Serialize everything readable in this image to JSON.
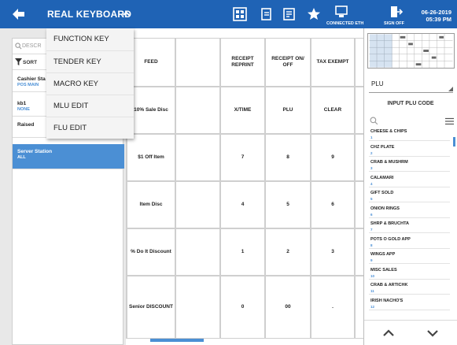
{
  "header": {
    "title": "REAL KEYBOARD",
    "connected_label": "CONNECTED ETH",
    "signoff_label": "SIGN OFF",
    "date": "06-26-2019",
    "time": "05:39 PM"
  },
  "dropdown_menu": {
    "items": [
      {
        "label": "FUNCTION KEY"
      },
      {
        "label": "TENDER KEY"
      },
      {
        "label": "MACRO KEY"
      },
      {
        "label": "MLU EDIT"
      },
      {
        "label": "FLU EDIT"
      }
    ]
  },
  "left_panel": {
    "search_placeholder": "DESCR",
    "sort_label": "SORT",
    "keyboards": [
      {
        "name": "Cashier Sta",
        "sub": "POS MAIN",
        "selected": false
      },
      {
        "name": "kb1",
        "sub": "NONE",
        "selected": false
      },
      {
        "name": "Raised",
        "sub": "",
        "selected": false
      },
      {
        "name": "Server Station",
        "sub": "ALL",
        "selected": true
      }
    ]
  },
  "keys": {
    "rows": [
      [
        "FEED",
        "",
        "RECEIPT REPRINT",
        "RECEIPT ON/ OFF",
        "TAX EXEMPT",
        ""
      ],
      [
        "10% Sale Disc",
        "",
        "X/TIME",
        "PLU",
        "CLEAR",
        ""
      ],
      [
        "$1 Off Item",
        "",
        "7",
        "8",
        "9",
        ""
      ],
      [
        "Item Disc",
        "",
        "4",
        "5",
        "6",
        ""
      ],
      [
        "% Do It Discount",
        "",
        "1",
        "2",
        "3",
        ""
      ],
      [
        "Senior DISCOUNT",
        "",
        "0",
        "00",
        ".",
        ""
      ]
    ]
  },
  "right_panel": {
    "type_select": "PLU",
    "input_button": "INPUT PLU CODE",
    "plu_items": [
      {
        "name": "CHEESE & CHIPS",
        "code": "1"
      },
      {
        "name": "CHZ PLATE",
        "code": "2"
      },
      {
        "name": "CRAB & MUSHRM",
        "code": "3"
      },
      {
        "name": "CALAMARI",
        "code": "4"
      },
      {
        "name": "GIFT SOLD",
        "code": "5"
      },
      {
        "name": "ONION RINGS",
        "code": "6"
      },
      {
        "name": "SHRP & BRUCHTA",
        "code": "7"
      },
      {
        "name": "POTS O GOLD APP",
        "code": "8"
      },
      {
        "name": "WINGS APP",
        "code": "9"
      },
      {
        "name": "MISC SALES",
        "code": "10"
      },
      {
        "name": "CRAB & ARTICHK",
        "code": "11"
      },
      {
        "name": "IRISH NACHO'S",
        "code": "12"
      }
    ]
  },
  "icons": {
    "back": "arrow-left-icon",
    "caret": "chevron-up-icon",
    "layout": "grid-layout-icon",
    "print": "printer-icon",
    "edit": "edit-note-icon",
    "favorite": "star-icon",
    "connection": "monitor-connection-icon",
    "signoff": "sign-out-icon",
    "sort": "filter-funnel-icon",
    "search": "search-icon",
    "menu": "hamburger-menu-icon",
    "up": "chevron-up-icon",
    "down": "chevron-down-icon"
  },
  "colors": {
    "header_bg": "#1f63b5",
    "selected_bg": "#4b8fd4",
    "accent_text": "#4a8fd6"
  }
}
